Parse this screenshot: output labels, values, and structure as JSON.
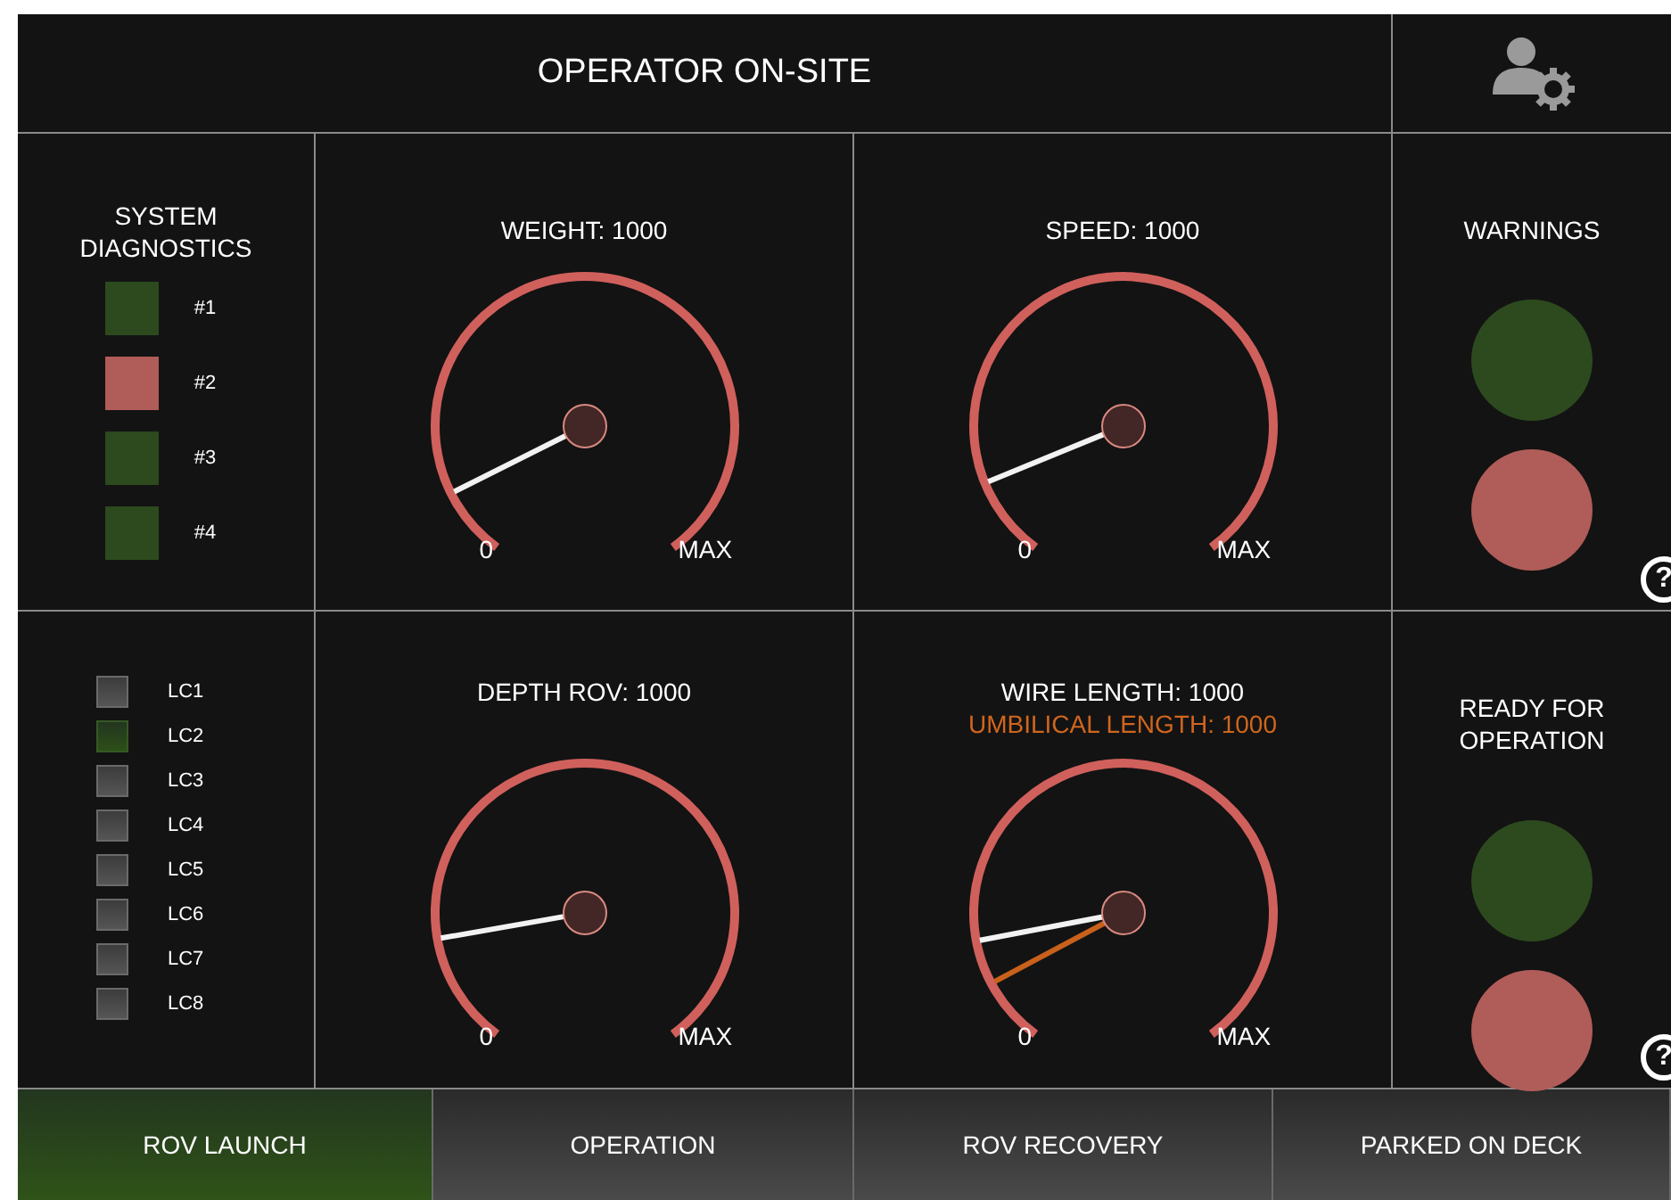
{
  "header": {
    "title": "OPERATOR ON-SITE"
  },
  "diagnostics": {
    "title": "SYSTEM DIAGNOSTICS",
    "items": [
      {
        "label": "#1",
        "color": "#2c4a1e"
      },
      {
        "label": "#2",
        "color": "#b05c58"
      },
      {
        "label": "#3",
        "color": "#2c4a1e"
      },
      {
        "label": "#4",
        "color": "#2c4a1e"
      }
    ]
  },
  "lc_list": [
    {
      "label": "LC1",
      "on": false
    },
    {
      "label": "LC2",
      "on": true
    },
    {
      "label": "LC3",
      "on": false
    },
    {
      "label": "LC4",
      "on": false
    },
    {
      "label": "LC5",
      "on": false
    },
    {
      "label": "LC6",
      "on": false
    },
    {
      "label": "LC7",
      "on": false
    },
    {
      "label": "LC8",
      "on": false
    }
  ],
  "gauges": [
    {
      "readings": [
        {
          "text": "WEIGHT: 1000",
          "kind": "primary"
        }
      ],
      "min_label": "0",
      "max_label": "MAX",
      "needles": [
        {
          "kind": "primary"
        }
      ]
    },
    {
      "readings": [
        {
          "text": "SPEED: 1000",
          "kind": "primary"
        }
      ],
      "min_label": "0",
      "max_label": "MAX",
      "needles": [
        {
          "kind": "primary"
        }
      ]
    },
    {
      "readings": [
        {
          "text": "DEPTH ROV: 1000",
          "kind": "primary"
        }
      ],
      "min_label": "0",
      "max_label": "MAX",
      "needles": [
        {
          "kind": "primary"
        }
      ]
    },
    {
      "readings": [
        {
          "text": "WIRE LENGTH: 1000",
          "kind": "primary"
        },
        {
          "text": "UMBILICAL LENGTH: 1000",
          "kind": "secondary"
        }
      ],
      "min_label": "0",
      "max_label": "MAX",
      "needles": [
        {
          "kind": "primary"
        },
        {
          "kind": "secondary"
        }
      ]
    }
  ],
  "status_panels": [
    {
      "title": "WARNINGS",
      "lamps": [
        {
          "color": "#2c4a1e"
        },
        {
          "color": "#b05c58"
        }
      ],
      "help": "?"
    },
    {
      "title": "READY FOR OPERATION",
      "lamps": [
        {
          "color": "#2c4a1e"
        },
        {
          "color": "#b05c58"
        }
      ],
      "help": "?"
    }
  ],
  "tabs": [
    {
      "label": "ROV LAUNCH",
      "selected": true
    },
    {
      "label": "OPERATION",
      "selected": false
    },
    {
      "label": "ROV RECOVERY",
      "selected": false
    },
    {
      "label": "PARKED ON DECK",
      "selected": false
    }
  ]
}
